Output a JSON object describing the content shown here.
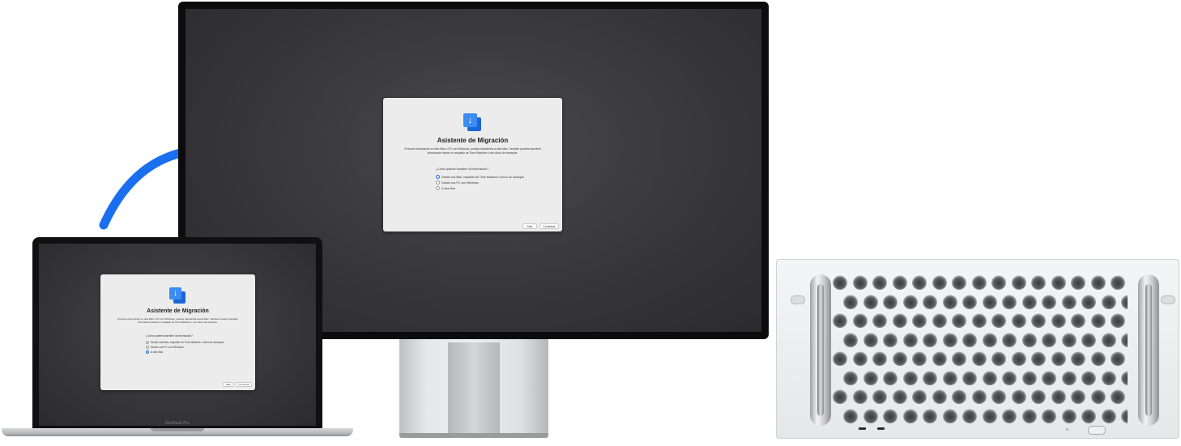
{
  "display_dialog": {
    "title": "Asistente de Migración",
    "description": "Si tienes información en otra Mac o PC con Windows, puedes transferirla a esta Mac. También puedes transferir información desde un respaldo de Time Machine o otro disco de arranque.",
    "question": "¿Cómo quieres transferir la información?",
    "options": [
      {
        "label": "Desde una Mac, respaldo de Time Machine o disco de arranque",
        "selected": true
      },
      {
        "label": "Desde una PC con Windows",
        "selected": false
      },
      {
        "label": "A otra Mac",
        "selected": false
      }
    ],
    "quit_label": "Salir",
    "continue_label": "Continuar"
  },
  "laptop_dialog": {
    "title": "Asistente de Migración",
    "description": "Si tienes información en otra Mac o PC con Windows, puedes transferirla a esta Mac. También puedes transferir información desde un respaldo de Time Machine o otro disco de arranque.",
    "question": "¿Cómo quieres transferir la información?",
    "options": [
      {
        "label": "Desde una Mac, respaldo de Time Machine o disco de arranque",
        "selected": false
      },
      {
        "label": "Desde una PC con Windows",
        "selected": false
      },
      {
        "label": "A otra Mac",
        "selected": true
      }
    ],
    "quit_label": "Salir",
    "continue_label": "Continuar"
  },
  "laptop_label": "MacBook Pro",
  "icons": {
    "migration": "migration-assistant-icon",
    "arrow": "curved-arrow-icon"
  },
  "colors": {
    "arrow": "#1a6ff0",
    "accent": "#1f6fe5"
  }
}
